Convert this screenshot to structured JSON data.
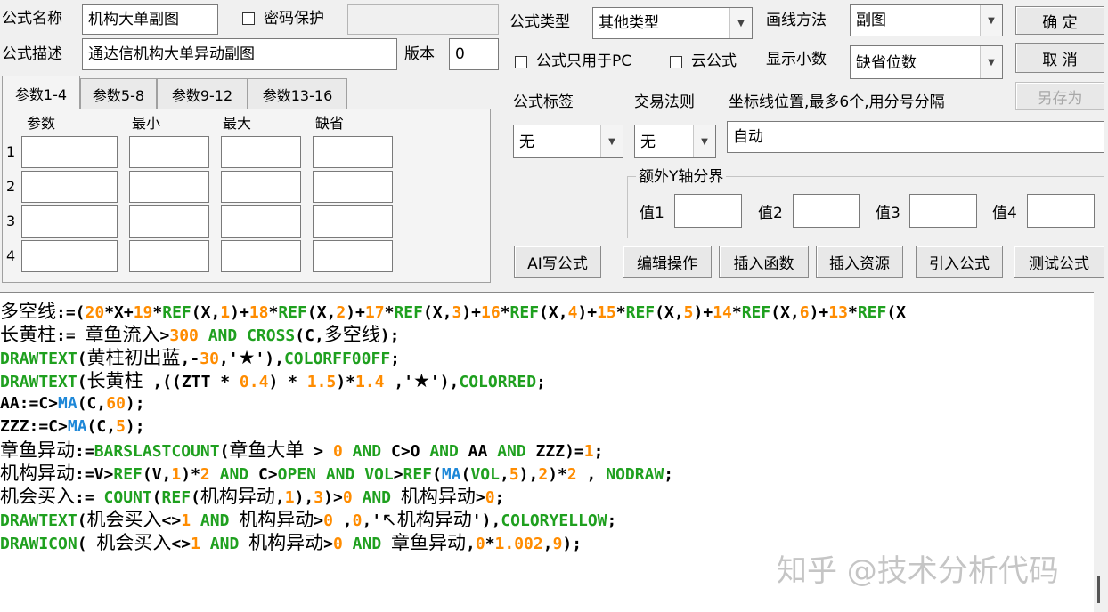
{
  "form": {
    "name_label": "公式名称",
    "name_value": "机构大单副图",
    "password_label": "密码保护",
    "desc_label": "公式描述",
    "desc_value": "通达信机构大单异动副图",
    "version_label": "版本",
    "version_value": "0",
    "type_label": "公式类型",
    "type_value": "其他类型",
    "draw_label": "画线方法",
    "draw_value": "副图",
    "pc_only_label": "公式只用于PC",
    "cloud_label": "云公式",
    "decimals_label": "显示小数",
    "decimals_value": "缺省位数",
    "tag_label": "公式标签",
    "tag_value": "无",
    "trade_label": "交易法则",
    "trade_value": "无",
    "coord_label": "坐标线位置,最多6个,用分号分隔",
    "coord_value": "自动",
    "extra_y_label": "额外Y轴分界",
    "val1_label": "值1",
    "val2_label": "值2",
    "val3_label": "值3",
    "val4_label": "值4"
  },
  "buttons": {
    "ok": "确 定",
    "cancel": "取 消",
    "save_as": "另存为",
    "ai_write": "AI写公式",
    "edit_ops": "编辑操作",
    "insert_func": "插入函数",
    "insert_res": "插入资源",
    "import_formula": "引入公式",
    "test_formula": "测试公式"
  },
  "tabs": [
    "参数1-4",
    "参数5-8",
    "参数9-12",
    "参数13-16"
  ],
  "params": {
    "headers": [
      "参数",
      "最小",
      "最大",
      "缺省"
    ],
    "rows": [
      "1",
      "2",
      "3",
      "4"
    ]
  },
  "code_lines": [
    "多空线:=(20*X+19*REF(X,1)+18*REF(X,2)+17*REF(X,3)+16*REF(X,4)+15*REF(X,5)+14*REF(X,6)+13*REF(X",
    "长黄柱:= 章鱼流入>300 AND CROSS(C,多空线);",
    "DRAWTEXT(黄柱初出蓝,-30,'★'),COLORFF00FF;",
    "DRAWTEXT(长黄柱 ,((ZTT * 0.4) * 1.5)*1.4 ,'★'),COLORRED;",
    "AA:=C>MA(C,60);",
    "ZZZ:=C>MA(C,5);",
    "章鱼异动:=BARSLASTCOUNT(章鱼大单 > 0 AND C>O AND AA AND ZZZ)=1;",
    "机构异动:=V>REF(V,1)*2 AND C>OPEN AND VOL>REF(MA(VOL,5),2)*2 , NODRAW;",
    "机会买入:= COUNT(REF(机构异动,1),3)>0 AND 机构异动>0;",
    "DRAWTEXT(机会买入<>1 AND 机构异动>0 ,0,'↖机构异动'),COLORYELLOW;",
    "DRAWICON( 机会买入<>1 AND 机构异动>0 AND 章鱼异动,0*1.002,9);"
  ],
  "watermark": "知乎 @技术分析代码",
  "colors": {
    "keyword": "#1fa01f",
    "number": "#ff8c00",
    "function": "#1e88d8"
  }
}
